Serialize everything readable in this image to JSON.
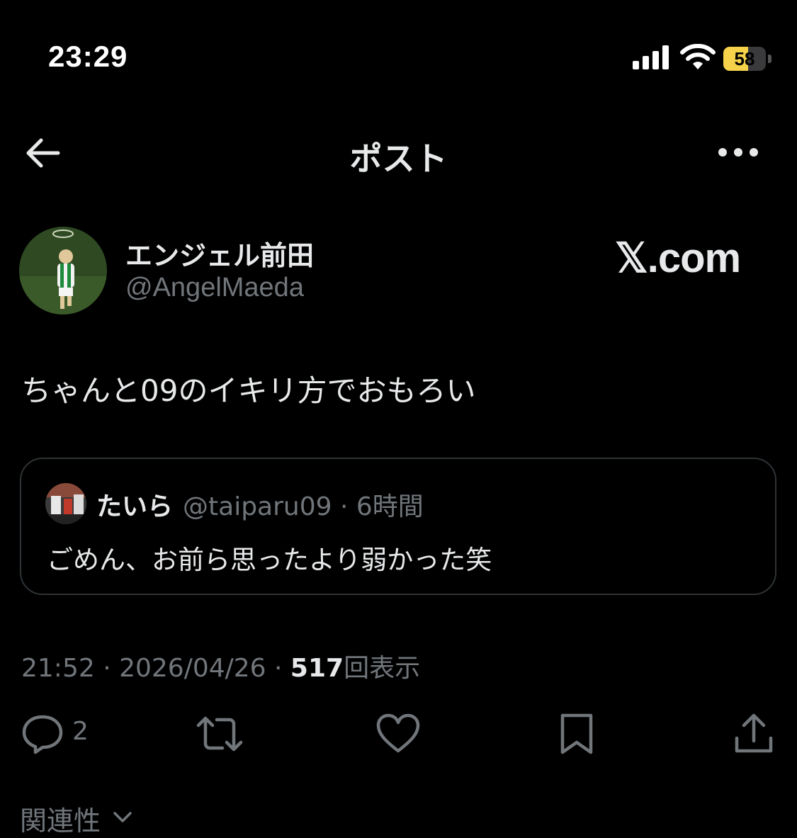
{
  "status_bar": {
    "time": "23:29",
    "battery": "58",
    "battery_level": 0.58,
    "battery_color": "#f5d24a"
  },
  "header": {
    "title": "ポスト",
    "back_icon": "arrow-left-icon",
    "more_icon": "more-horizontal-icon"
  },
  "post": {
    "author_name": "エンジェル前田",
    "author_handle": "@AngelMaeda",
    "watermark": "𝕏.com",
    "text": "ちゃんと09のイキリ方でおもろい",
    "timestamp": "21:52 · 2026/04/26 · ",
    "views": "517",
    "views_label": "回表示"
  },
  "quote": {
    "name": "たいら",
    "meta": "@taiparu09 · 6時間",
    "text": "ごめん、お前ら思ったより弱かった笑"
  },
  "actions": {
    "reply_count": "2",
    "icons": [
      "reply-icon",
      "repost-icon",
      "like-icon",
      "bookmark-icon",
      "share-icon"
    ]
  },
  "related": {
    "label": "関連性"
  },
  "colors": {
    "background": "#000000",
    "text": "#e7e9ea",
    "muted": "#71767b",
    "border": "#2f3336"
  }
}
